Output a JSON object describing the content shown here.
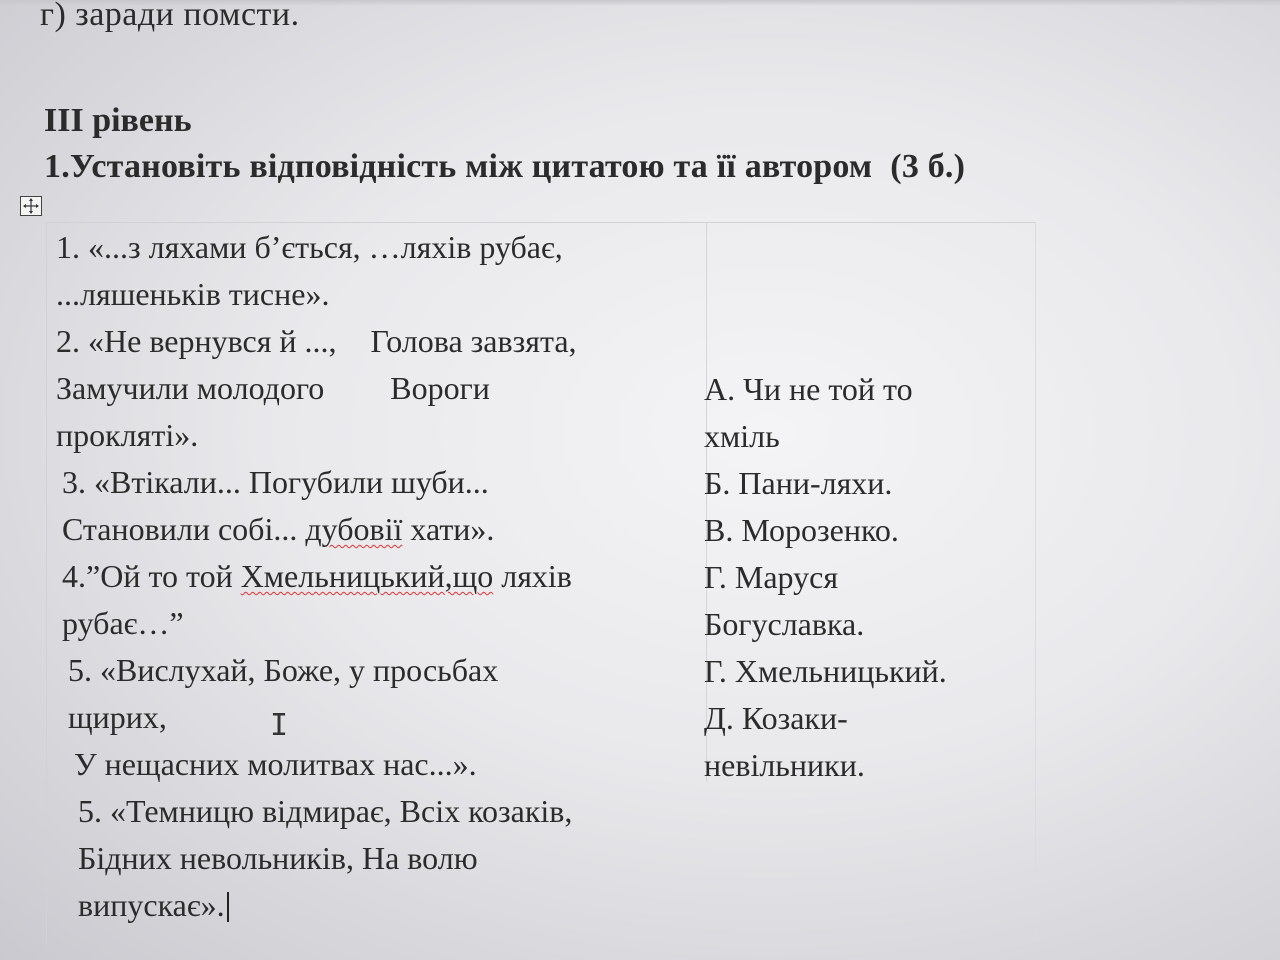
{
  "document": {
    "previous_line": "г) заради помсти.",
    "level_heading": "ІІІ рівень",
    "task": {
      "title": "1.Установіть відповідність між цитатою та її автором",
      "points": "(3 б.)"
    },
    "quotes": [
      {
        "lines": [
          "1. «...з ляхами б’ється, …ляхів рубає,",
          "...ляшеньків тисне»."
        ]
      },
      {
        "lines": [
          "2. «Не вернувся й ...,",
          "Голова завзята,",
          "Замучили молодого",
          "Вороги",
          "прокляті»."
        ]
      },
      {
        "lines": [
          "3. «Втікали... Погубили шуби...",
          "Становили собі... дубовії хати»."
        ]
      },
      {
        "lines": [
          "4.”Ой то той Хмельницький,що ляхів",
          "рубає…”"
        ]
      },
      {
        "lines": [
          "5. «Вислухай, Боже, у просьбах",
          "щирих,",
          "У нещасних молитвах нас...»."
        ]
      },
      {
        "lines": [
          "5. «Темницю відмирає,  Всіх козаків,",
          "Бідних невольників,  На волю",
          "випускає»."
        ]
      }
    ],
    "authors": [
      "А. Чи не той то",
      "хміль",
      "Б. Пани-ляхи.",
      "В. Морозенко.",
      "Г. Маруся",
      "Богуславка.",
      "Г. Хмельницький.",
      "Д. Козаки-",
      "невільники."
    ]
  }
}
